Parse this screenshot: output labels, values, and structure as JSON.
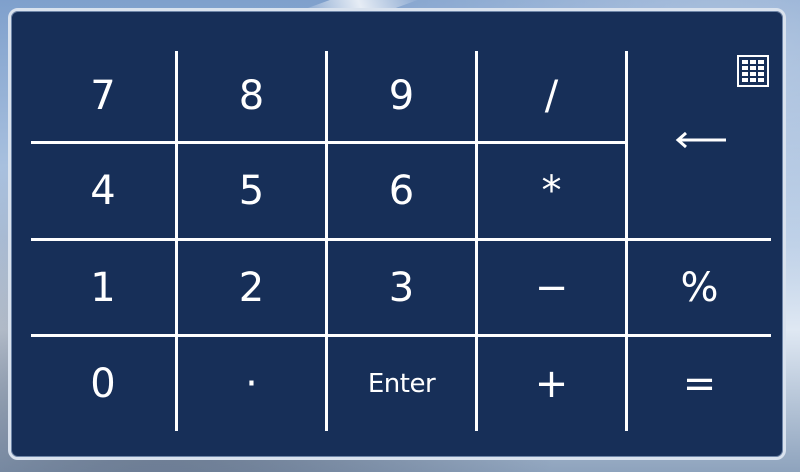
{
  "keypad": {
    "keys": {
      "k7": "7",
      "k8": "8",
      "k9": "9",
      "divide": "/",
      "k4": "4",
      "k5": "5",
      "k6": "6",
      "multiply": "*",
      "k1": "1",
      "k2": "2",
      "k3": "3",
      "minus": "−",
      "percent": "%",
      "k0": "0",
      "decimal": "·",
      "enter": "Enter",
      "plus": "+",
      "equals": "="
    },
    "icons": {
      "keyboard": "keyboard-icon",
      "backspace": "backspace-arrow-icon"
    },
    "colors": {
      "panel": "#172f58",
      "lines": "#ffffff",
      "text": "#ffffff"
    }
  }
}
